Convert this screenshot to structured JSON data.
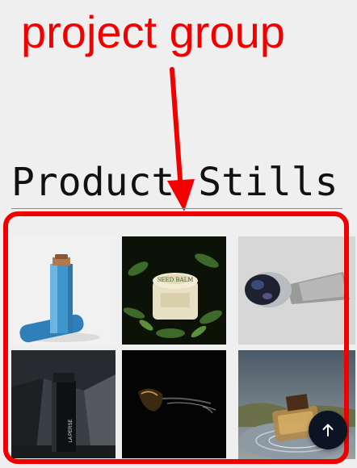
{
  "annotation": {
    "label": "project group",
    "color": "#f20000"
  },
  "section": {
    "title": "Product Stills"
  },
  "gallery": {
    "items": [
      {
        "name": "blue-tube-product",
        "alt": ""
      },
      {
        "name": "balm-jar-product",
        "alt": "",
        "jar_label": "SEED BALM"
      },
      {
        "name": "vr-headset-product",
        "alt": ""
      },
      {
        "name": "perfume-bottle-black",
        "alt": "",
        "bottle_label": "LA PERSE"
      },
      {
        "name": "sunglasses-product",
        "alt": ""
      },
      {
        "name": "perfume-bottle-water",
        "alt": ""
      }
    ]
  },
  "back_to_top": {
    "icon": "arrow-up-icon"
  }
}
